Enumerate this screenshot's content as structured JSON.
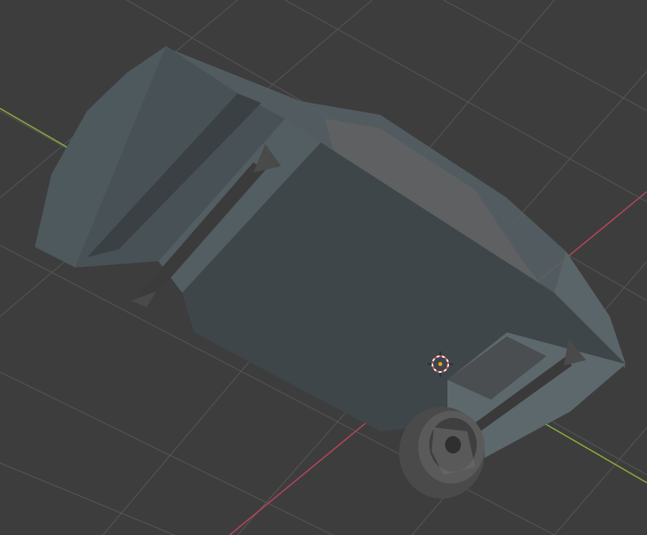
{
  "viewport": {
    "background": "#3d3d3d",
    "grid_color": "#555555",
    "x_axis_color": "#b5455a",
    "y_axis_color": "#8aab3c",
    "model_color": "#4c5659",
    "cursor": {
      "name": "3d-cursor-icon",
      "ring_colors": [
        "#e04848",
        "#ffffff"
      ]
    }
  }
}
